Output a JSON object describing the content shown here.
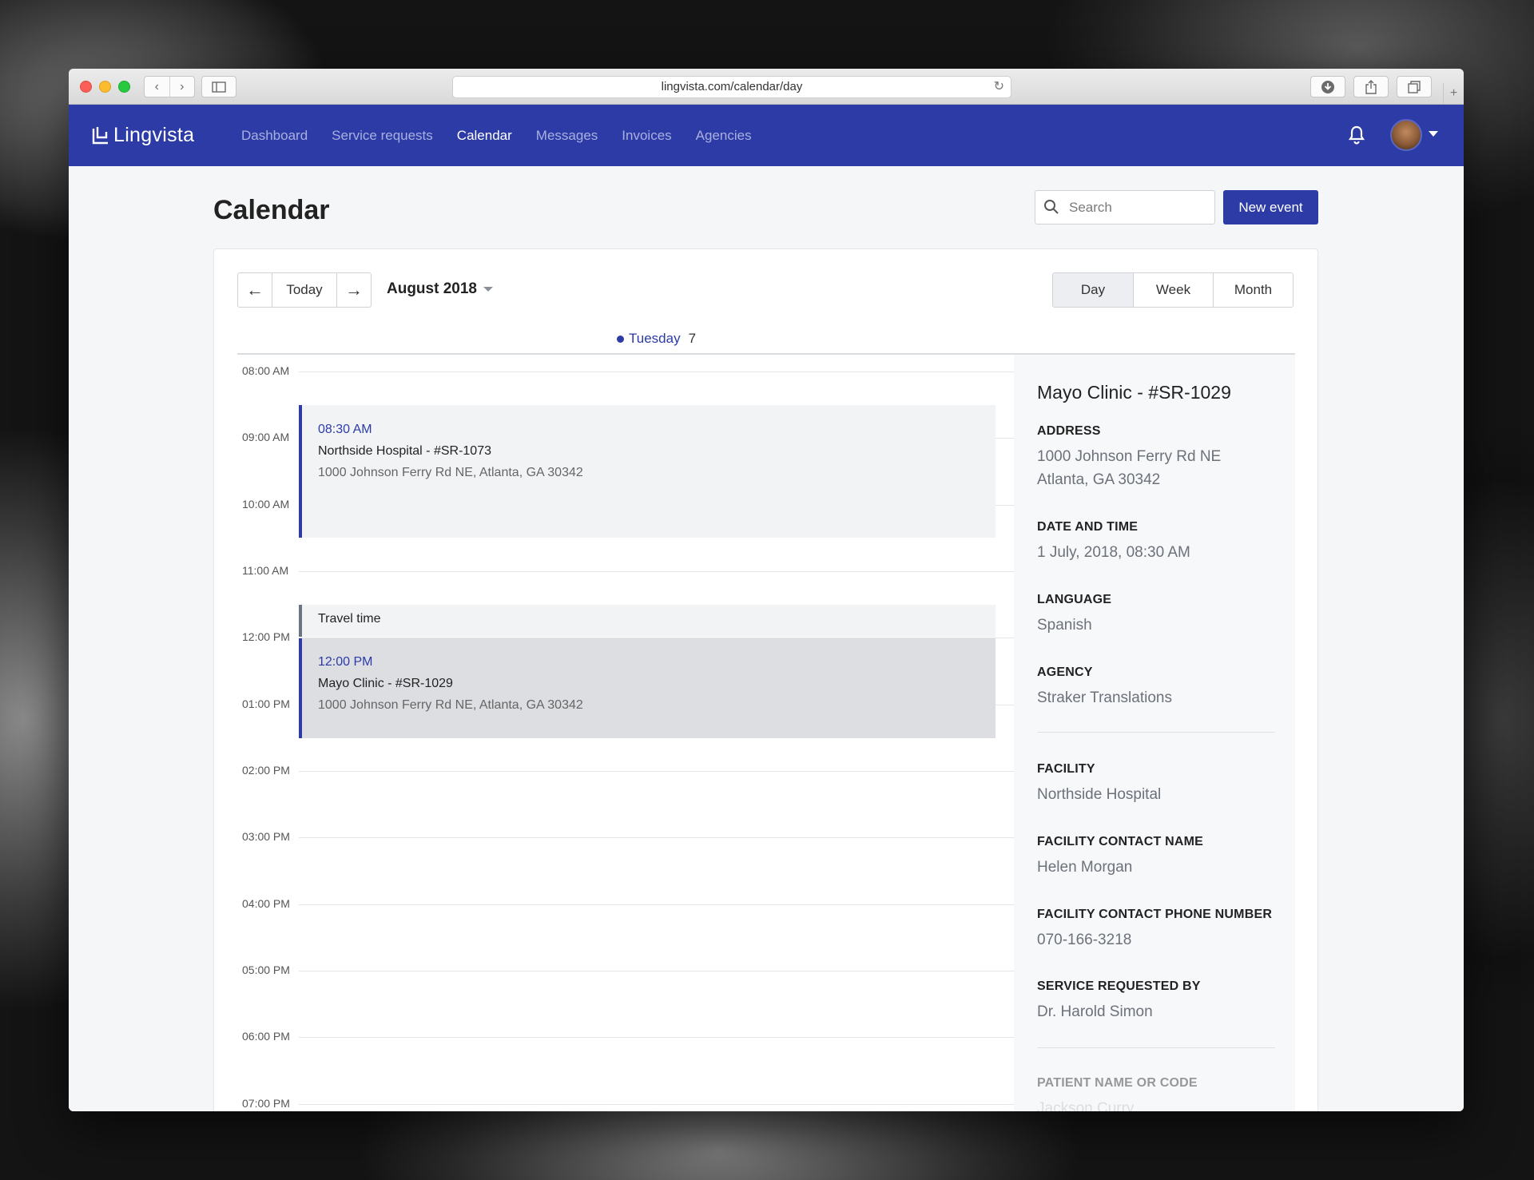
{
  "browser": {
    "url": "lingvista.com/calendar/day"
  },
  "app": {
    "brand": "Lingvista",
    "nav": [
      "Dashboard",
      "Service requests",
      "Calendar",
      "Messages",
      "Invoices",
      "Agencies"
    ],
    "active_nav": "Calendar"
  },
  "page": {
    "title": "Calendar",
    "search_placeholder": "Search",
    "new_event_label": "New event"
  },
  "toolbar": {
    "today_label": "Today",
    "month_label": "August 2018",
    "views": [
      "Day",
      "Week",
      "Month"
    ],
    "active_view": "Day"
  },
  "day": {
    "name": "Tuesday",
    "number": "7"
  },
  "time_slots": [
    "08:00 AM",
    "09:00 AM",
    "10:00 AM",
    "11:00 AM",
    "12:00 PM",
    "01:00 PM",
    "02:00 PM",
    "03:00 PM",
    "04:00 PM",
    "05:00 PM",
    "06:00 PM",
    "07:00 PM"
  ],
  "events": [
    {
      "time": "08:30 AM",
      "title": "Northside Hospital - #SR-1073",
      "address": "1000 Johnson Ferry Rd NE, Atlanta, GA 30342"
    },
    {
      "travel_label": "Travel time"
    },
    {
      "time": "12:00 PM",
      "title": "Mayo Clinic - #SR-1029",
      "address": "1000 Johnson Ferry Rd NE, Atlanta, GA 30342"
    }
  ],
  "details": {
    "title": "Mayo Clinic - #SR-1029",
    "address_label": "ADDRESS",
    "address_line1": "1000 Johnson Ferry Rd NE",
    "address_line2": "Atlanta, GA 30342",
    "datetime_label": "DATE AND TIME",
    "datetime": "1 July, 2018, 08:30 AM",
    "language_label": "LANGUAGE",
    "language": "Spanish",
    "agency_label": "AGENCY",
    "agency": "Straker Translations",
    "facility_label": "FACILITY",
    "facility": "Northside Hospital",
    "contact_name_label": "FACILITY CONTACT NAME",
    "contact_name": "Helen Morgan",
    "contact_phone_label": "FACILITY CONTACT PHONE NUMBER",
    "contact_phone": "070-166-3218",
    "requested_by_label": "SERVICE REQUESTED BY",
    "requested_by": "Dr. Harold Simon",
    "patient_label": "PATIENT NAME OR CODE",
    "patient": "Jackson Curry"
  },
  "colors": {
    "brand": "#2c3ba6",
    "nav_inactive": "#a9b0e0"
  }
}
